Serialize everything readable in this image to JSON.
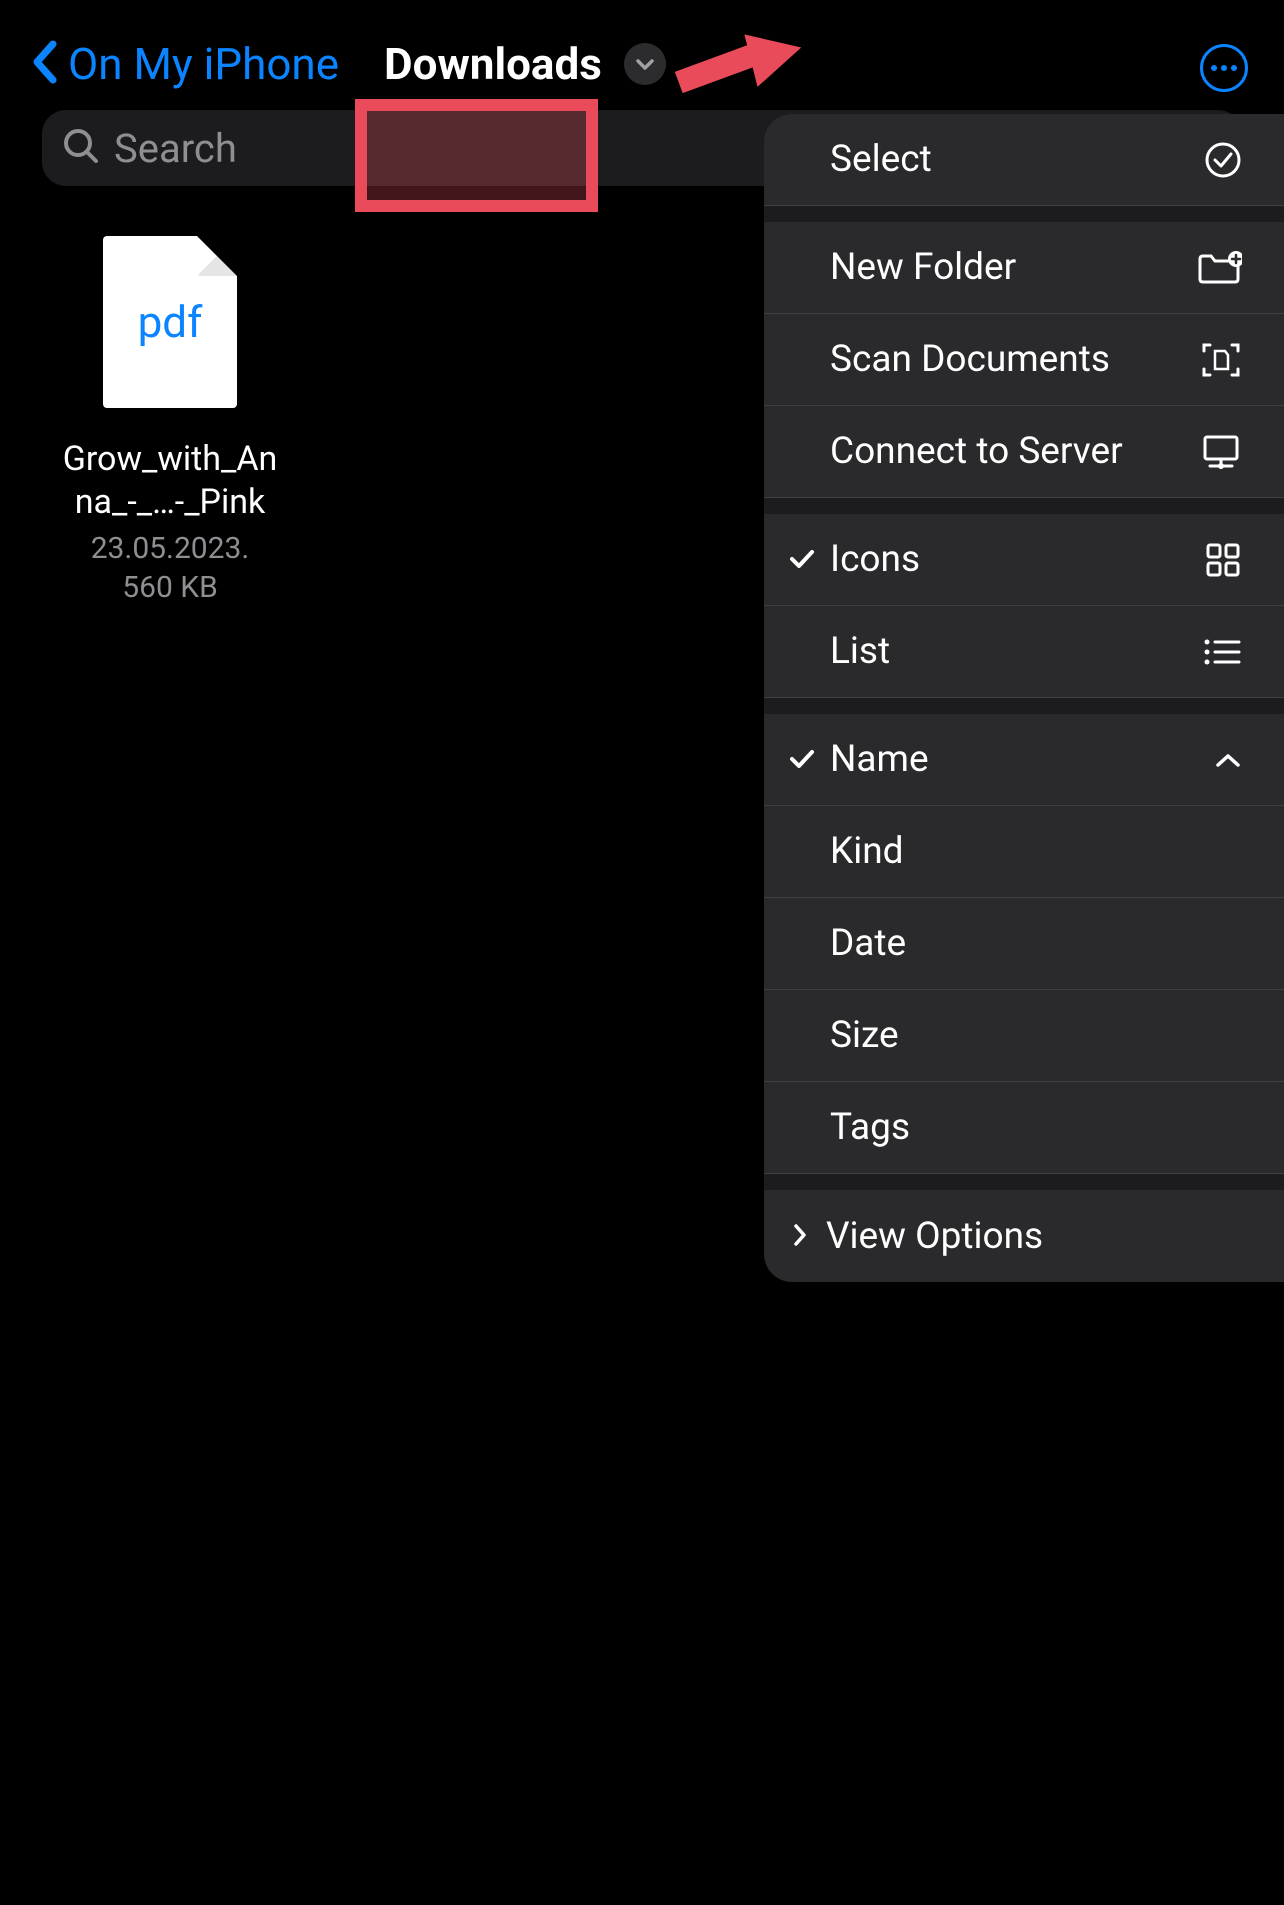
{
  "nav": {
    "back_label": "On My iPhone",
    "title": "Downloads"
  },
  "search": {
    "placeholder": "Search"
  },
  "file": {
    "ext": "pdf",
    "name": "Grow_with_Anna_-_…-_Pink",
    "date": "23.05.2023.",
    "size": "560 KB"
  },
  "menu": {
    "select": "Select",
    "new_folder": "New Folder",
    "scan_documents": "Scan Documents",
    "connect_server": "Connect to Server",
    "icons": "Icons",
    "list": "List",
    "name": "Name",
    "kind": "Kind",
    "date": "Date",
    "size": "Size",
    "tags": "Tags",
    "view_options": "View Options"
  }
}
